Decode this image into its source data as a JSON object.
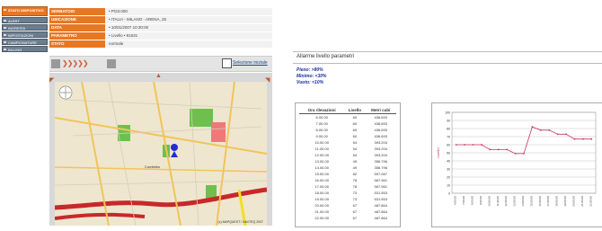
{
  "nav": {
    "items": [
      {
        "label": "STATO DISPOSITIVO",
        "active": true
      },
      {
        "label": "ALERT"
      },
      {
        "label": "INGRESSI"
      },
      {
        "label": "IMPOSTAZIONI"
      },
      {
        "label": "CAMPIONATURE"
      },
      {
        "label": "BILLING"
      }
    ]
  },
  "info": [
    {
      "key": "SERBATOIO",
      "value": "• P/23.000"
    },
    {
      "key": "UBICAZIONE",
      "value": "• ITALIA - MILANO - ARENA, 25"
    },
    {
      "key": "DATA",
      "value": "• 10/01/2007 10:30:00"
    },
    {
      "key": "PARAMETRO",
      "value": "• Livello • 91631"
    },
    {
      "key": "STATO",
      "value": "normale"
    }
  ],
  "toolbar": {
    "link": "Selezione iniziale"
  },
  "map": {
    "city_label": "Comitelia",
    "copyright": "(c) MAPQUEST / NAVTEQ 2007"
  },
  "report": {
    "title": "Allarme livello parametri",
    "legend": [
      "Pieno: >80%",
      "Minimo: <30%",
      "Vuoto: <10%"
    ],
    "table": {
      "headers": [
        "Ora rilevazioni",
        "Livello",
        "Metri cubi"
      ],
      "rows": [
        [
          "6.00.00",
          "60",
          "436.693"
        ],
        [
          "7.00.00",
          "60",
          "436.693"
        ],
        [
          "8.00.00",
          "60",
          "436.693"
        ],
        [
          "9.00.00",
          "60",
          "436.693"
        ],
        [
          "10.00.00",
          "54",
          "393.204"
        ],
        [
          "11.00.00",
          "54",
          "393.204"
        ],
        [
          "12.00.00",
          "54",
          "393.204"
        ],
        [
          "13.00.00",
          "49",
          "356.796"
        ],
        [
          "14.00.00",
          "49",
          "356.796"
        ],
        [
          "15.00.00",
          "82",
          "597.087"
        ],
        [
          "16.00.00",
          "78",
          "567.961"
        ],
        [
          "17.00.00",
          "78",
          "567.961"
        ],
        [
          "18.00.00",
          "73",
          "531.553"
        ],
        [
          "19.00.00",
          "73",
          "531.553"
        ],
        [
          "20.00.00",
          "67",
          "487.864"
        ],
        [
          "21.00.00",
          "67",
          "487.864"
        ],
        [
          "22.00.00",
          "67",
          "487.864"
        ]
      ]
    }
  },
  "chart_data": {
    "type": "line",
    "title": "",
    "xlabel": "",
    "ylabel": "Livello",
    "ylim": [
      0,
      100
    ],
    "yticks": [
      0,
      10,
      20,
      30,
      40,
      50,
      60,
      70,
      80,
      90,
      100
    ],
    "x": [
      "6.00.00",
      "7.00.00",
      "8.00.00",
      "9.00.00",
      "10.00.00",
      "11.00.00",
      "12.00.00",
      "13.00.00",
      "14.00.00",
      "15.00.00",
      "16.00.00",
      "17.00.00",
      "18.00.00",
      "19.00.00",
      "20.00.00",
      "21.00.00",
      "22.00.00"
    ],
    "series": [
      {
        "values": [
          60,
          60,
          60,
          60,
          54,
          54,
          54,
          49,
          49,
          82,
          78,
          78,
          73,
          73,
          67,
          67,
          67
        ],
        "color": "#c8385a"
      }
    ],
    "grid": true
  }
}
